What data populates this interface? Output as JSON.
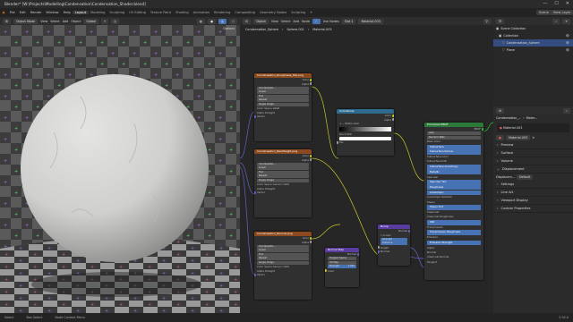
{
  "titlebar": {
    "title": "Blender* [W:\\Projects\\Modelling\\Condensation\\Condensation_Shader.blend]"
  },
  "menubar": {
    "menus": [
      "File",
      "Edit",
      "Render",
      "Window",
      "Help"
    ],
    "workspaces": [
      "Layout",
      "Modeling",
      "Sculpting",
      "UV Editing",
      "Texture Paint",
      "Shading",
      "Animation",
      "Rendering",
      "Compositing",
      "Geometry Nodes",
      "Scripting"
    ],
    "active_workspace": "Layout",
    "scene_label": "Scene",
    "view_layer_label": "View Layer"
  },
  "viewport_header": {
    "mode": "Object Mode",
    "menus": [
      "View",
      "Select",
      "Add",
      "Object"
    ],
    "orientation": "Global",
    "options_label": "Options"
  },
  "node_header": {
    "mode": "Object",
    "menus": [
      "View",
      "Select",
      "Add",
      "Node"
    ],
    "use_nodes_label": "Use Nodes",
    "slot": "Slot 1",
    "material": "Material.003"
  },
  "breadcrumb": [
    "Condensation_Sphere",
    "Sphere.001",
    "Material.003"
  ],
  "nodes": {
    "roughness": {
      "title": "Condensation_Roughness_Mix.png",
      "rows": [
        "Color",
        "Alpha",
        "Condensatio...",
        "Linear",
        "Flat",
        "Repeat",
        "Single Image",
        "Color Space",
        "sRGB",
        "Alpha",
        "Straight",
        "Vector"
      ]
    },
    "normal": {
      "title": "Condensation_NewHeight.png",
      "rows": [
        "Color",
        "Alpha",
        "Condensatio...",
        "Linear",
        "Flat",
        "Repeat",
        "Single Image",
        "Color Space",
        "Generic Data",
        "Alpha",
        "Straight",
        "Vector"
      ]
    },
    "height": {
      "title": "Condensation_Normal.png",
      "rows": [
        "Color",
        "Alpha",
        "Condensatio...",
        "Linear",
        "Flat",
        "Repeat",
        "Single Image",
        "Color Space",
        "Generic Data",
        "Alpha",
        "Straight",
        "Vector"
      ]
    },
    "colorramp": {
      "title": "ColorRamp",
      "rows": [
        "Color",
        "Alpha",
        "RGB",
        "Linear",
        "Pos",
        "0.500",
        "Fac"
      ]
    },
    "bsdf": {
      "title": "Principled BSDF",
      "out": "BSDF",
      "rows": [
        "GGX",
        "Random Walk",
        "Base Color",
        "Subsurface",
        "Subsurface Radius",
        "Subsurface Color",
        "Subsurface IOR",
        "Subsurface Anisotropy",
        "Metallic",
        "Specular",
        "Specular Tint",
        "Roughness",
        "Anisotropic",
        "Anisotropic Rotation",
        "Sheen",
        "Sheen Tint",
        "Clearcoat",
        "Clearcoat Roughness",
        "IOR",
        "Transmission",
        "Transmission Roughness",
        "Emission",
        "Emission Strength",
        "Alpha",
        "Normal",
        "Clearcoat Normal",
        "Tangent"
      ]
    },
    "bump": {
      "title": "Bump",
      "rows": [
        "Normal",
        "Invert",
        "Strength",
        "Distance",
        "Height",
        "Normal"
      ]
    },
    "normalmap": {
      "title": "Normal Map",
      "rows": [
        "Normal",
        "Tangent Space",
        "UV Map",
        "Strength",
        "1.000",
        "Color"
      ]
    }
  },
  "outliner": {
    "title": "Scene Collection",
    "items": [
      "Collection",
      "Condensation_Sphere",
      "Plane"
    ]
  },
  "properties": {
    "object": "Condensation_...",
    "material_tab": "Mater...",
    "material": "Material.003",
    "slot_material": "Material.003",
    "sections": [
      "Preview",
      "Surface",
      "Volume",
      "Displacement",
      "Settings",
      "Line Art",
      "Viewport Display",
      "Custom Properties"
    ],
    "displacement_label": "Displacem...",
    "displacement_value": "Default"
  },
  "statusbar": {
    "items": [
      "Select",
      "Box Select",
      "Node Context Menu"
    ],
    "version": "2.92.0"
  },
  "colors": {
    "accent": "#4772b3",
    "image_node": "#8c4a1e",
    "shader_node": "#2c7a3a",
    "vector_node": "#5a3ca0",
    "converter_node": "#2e6b8f"
  }
}
